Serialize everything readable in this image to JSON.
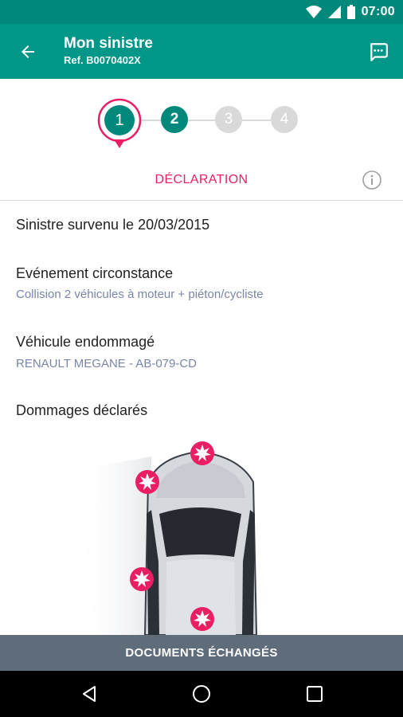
{
  "status_bar": {
    "time": "07:00",
    "icons": [
      "wifi-icon",
      "signal-icon",
      "battery-icon"
    ]
  },
  "app_bar": {
    "title": "Mon sinistre",
    "subtitle": "Ref. B0070402X",
    "back_icon": "arrow-back-icon",
    "chat_icon": "chat-bubble-icon"
  },
  "stepper": {
    "current": 1,
    "steps": [
      {
        "label": "1",
        "state": "current"
      },
      {
        "label": "2",
        "state": "done"
      },
      {
        "label": "3",
        "state": "upcoming"
      },
      {
        "label": "4",
        "state": "upcoming"
      }
    ]
  },
  "section": {
    "title": "DÉCLARATION",
    "info_icon": "info-icon"
  },
  "details": {
    "date_line": "Sinistre survenu le 20/03/2015",
    "event_title": "Evénement circonstance",
    "event_value": "Collision 2 véhicules à moteur + piéton/cycliste",
    "vehicle_title": "Véhicule endommagé",
    "vehicle_value": "RENAULT MEGANE - AB-079-CD",
    "damage_title": "Dommages déclarés"
  },
  "damage_points": [
    "front-center",
    "front-left",
    "left-side",
    "rear-center"
  ],
  "bottom_button": {
    "label": "DOCUMENTS ÉCHANGÉS"
  },
  "nav": {
    "back_icon": "nav-back-icon",
    "home_icon": "nav-home-icon",
    "recents_icon": "nav-recents-icon"
  },
  "colors": {
    "primary": "#009688",
    "status": "#00897b",
    "accent": "#e91e63",
    "inactive": "#d9d9d9",
    "bottom_bar": "#5f6c7a"
  }
}
